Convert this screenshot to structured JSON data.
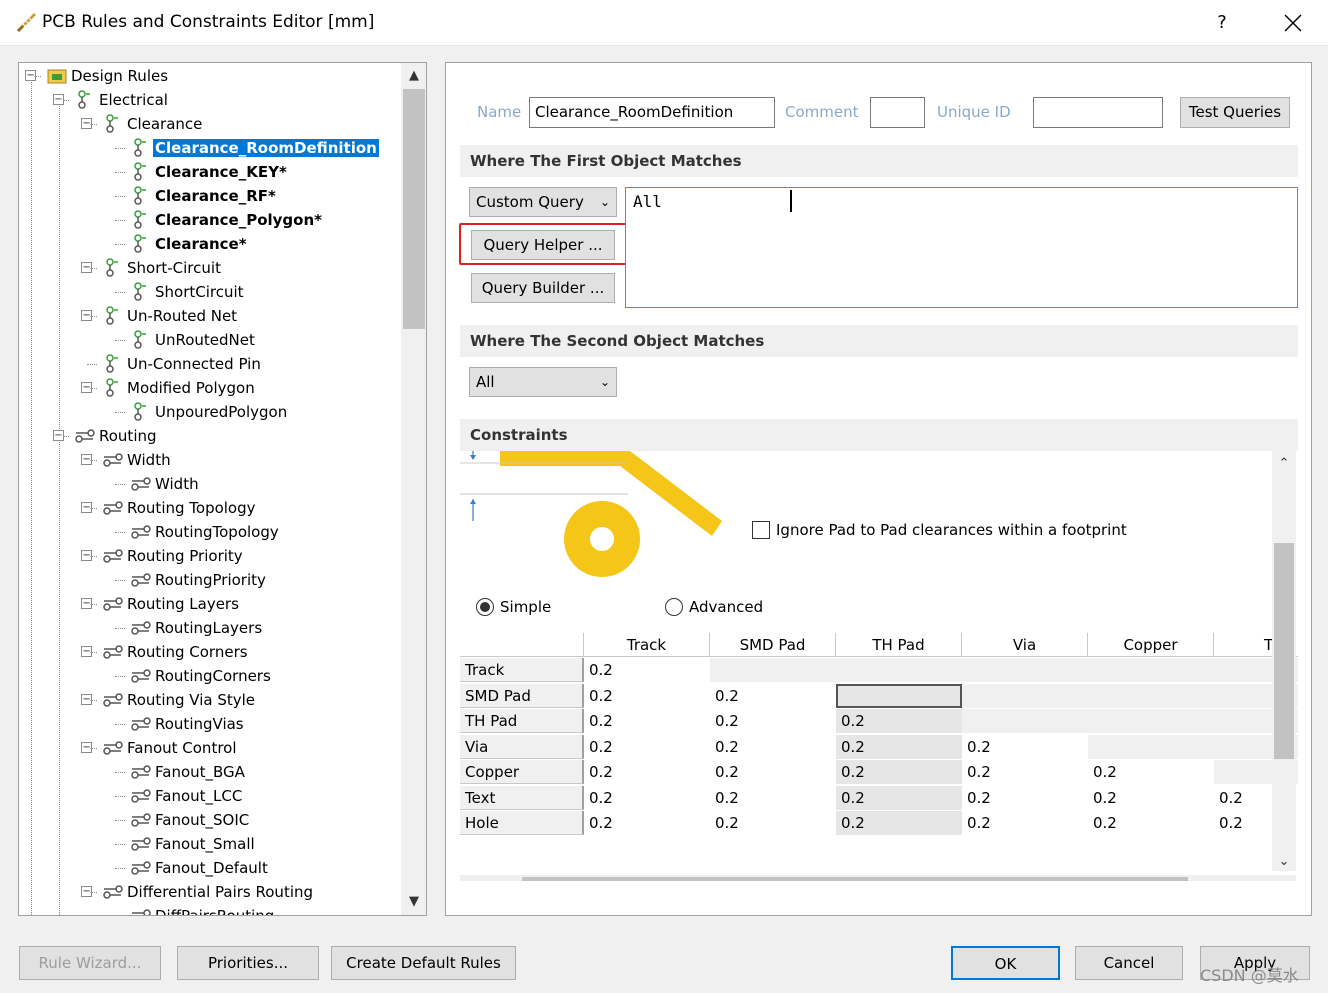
{
  "window": {
    "title": "PCB Rules and Constraints Editor [mm]",
    "help": "?",
    "close_icon": "close-icon"
  },
  "tree": {
    "items": [
      {
        "label": "Design Rules",
        "icon": "design-rules-icon",
        "expander": "-",
        "bold": false
      },
      {
        "label": "Electrical",
        "icon": "electrical-icon",
        "expander": "-",
        "bold": false
      },
      {
        "label": "Clearance",
        "icon": "rule-icon",
        "expander": "-",
        "bold": false
      },
      {
        "label": "Clearance_RoomDefinition",
        "icon": "rule-icon",
        "expander": "",
        "bold": true,
        "selected": true
      },
      {
        "label": "Clearance_KEY*",
        "icon": "rule-icon",
        "expander": "",
        "bold": true
      },
      {
        "label": "Clearance_RF*",
        "icon": "rule-icon",
        "expander": "",
        "bold": true
      },
      {
        "label": "Clearance_Polygon*",
        "icon": "rule-icon",
        "expander": "",
        "bold": true
      },
      {
        "label": "Clearance*",
        "icon": "rule-icon",
        "expander": "",
        "bold": true
      },
      {
        "label": "Short-Circuit",
        "icon": "rule-icon",
        "expander": "-",
        "bold": false
      },
      {
        "label": "ShortCircuit",
        "icon": "rule-icon",
        "expander": "",
        "bold": false
      },
      {
        "label": "Un-Routed Net",
        "icon": "rule-icon",
        "expander": "-",
        "bold": false
      },
      {
        "label": "UnRoutedNet",
        "icon": "rule-icon",
        "expander": "",
        "bold": false
      },
      {
        "label": "Un-Connected Pin",
        "icon": "rule-icon",
        "expander": "",
        "bold": false
      },
      {
        "label": "Modified Polygon",
        "icon": "rule-icon",
        "expander": "-",
        "bold": false
      },
      {
        "label": "UnpouredPolygon",
        "icon": "rule-icon",
        "expander": "",
        "bold": false
      },
      {
        "label": "Routing",
        "icon": "routing-icon",
        "expander": "-",
        "bold": false
      },
      {
        "label": "Width",
        "icon": "routing-icon",
        "expander": "-",
        "bold": false
      },
      {
        "label": "Width",
        "icon": "routing-icon",
        "expander": "",
        "bold": false
      },
      {
        "label": "Routing Topology",
        "icon": "routing-icon",
        "expander": "-",
        "bold": false
      },
      {
        "label": "RoutingTopology",
        "icon": "routing-icon",
        "expander": "",
        "bold": false
      },
      {
        "label": "Routing Priority",
        "icon": "routing-icon",
        "expander": "-",
        "bold": false
      },
      {
        "label": "RoutingPriority",
        "icon": "routing-icon",
        "expander": "",
        "bold": false
      },
      {
        "label": "Routing Layers",
        "icon": "routing-icon",
        "expander": "-",
        "bold": false
      },
      {
        "label": "RoutingLayers",
        "icon": "routing-icon",
        "expander": "",
        "bold": false
      },
      {
        "label": "Routing Corners",
        "icon": "routing-icon",
        "expander": "-",
        "bold": false
      },
      {
        "label": "RoutingCorners",
        "icon": "routing-icon",
        "expander": "",
        "bold": false
      },
      {
        "label": "Routing Via Style",
        "icon": "routing-icon",
        "expander": "-",
        "bold": false
      },
      {
        "label": "RoutingVias",
        "icon": "routing-icon",
        "expander": "",
        "bold": false
      },
      {
        "label": "Fanout Control",
        "icon": "routing-icon",
        "expander": "-",
        "bold": false
      },
      {
        "label": "Fanout_BGA",
        "icon": "routing-icon",
        "expander": "",
        "bold": false
      },
      {
        "label": "Fanout_LCC",
        "icon": "routing-icon",
        "expander": "",
        "bold": false
      },
      {
        "label": "Fanout_SOIC",
        "icon": "routing-icon",
        "expander": "",
        "bold": false
      },
      {
        "label": "Fanout_Small",
        "icon": "routing-icon",
        "expander": "",
        "bold": false
      },
      {
        "label": "Fanout_Default",
        "icon": "routing-icon",
        "expander": "",
        "bold": false
      },
      {
        "label": "Differential Pairs Routing",
        "icon": "routing-icon",
        "expander": "-",
        "bold": false
      },
      {
        "label": "DiffPairsRouting",
        "icon": "routing-icon",
        "expander": "",
        "bold": false
      }
    ]
  },
  "rule": {
    "name_label": "Name",
    "name_value": "Clearance_RoomDefinition",
    "comment_label": "Comment",
    "comment_value": "",
    "uid_label": "Unique ID",
    "uid_value": "",
    "test_queries": "Test Queries"
  },
  "first_match": {
    "header": "Where The First Object Matches",
    "combo_value": "Custom Query",
    "query_text": "All",
    "query_helper": "Query Helper ...",
    "query_builder": "Query Builder ..."
  },
  "second_match": {
    "header": "Where The Second Object Matches",
    "combo_value": "All"
  },
  "constraints": {
    "header": "Constraints",
    "ignore_pad_label": "Ignore Pad to Pad clearances within a footprint",
    "ignore_pad_checked": false,
    "mode_simple": "Simple",
    "mode_advanced": "Advanced",
    "selected_mode": "Simple",
    "accent_color": "#f5c518",
    "columns": [
      "Track",
      "SMD Pad",
      "TH Pad",
      "Via",
      "Copper",
      "T"
    ],
    "rows": [
      {
        "label": "Track",
        "values": [
          "0.2",
          "",
          "",
          "",
          "",
          ""
        ]
      },
      {
        "label": "SMD Pad",
        "values": [
          "0.2",
          "0.2",
          "",
          "",
          "",
          ""
        ]
      },
      {
        "label": "TH Pad",
        "values": [
          "0.2",
          "0.2",
          "0.2",
          "",
          "",
          ""
        ]
      },
      {
        "label": "Via",
        "values": [
          "0.2",
          "0.2",
          "0.2",
          "0.2",
          "",
          ""
        ]
      },
      {
        "label": "Copper",
        "values": [
          "0.2",
          "0.2",
          "0.2",
          "0.2",
          "0.2",
          ""
        ]
      },
      {
        "label": "Text",
        "values": [
          "0.2",
          "0.2",
          "0.2",
          "0.2",
          "0.2",
          "0.2"
        ]
      },
      {
        "label": "Hole",
        "values": [
          "0.2",
          "0.2",
          "0.2",
          "0.2",
          "0.2",
          "0.2"
        ]
      }
    ]
  },
  "footer": {
    "rule_wizard": "Rule Wizard...",
    "priorities": "Priorities...",
    "create_default": "Create Default Rules",
    "ok": "OK",
    "cancel": "Cancel",
    "apply": "Apply",
    "watermark": "CSDN @莫水"
  }
}
